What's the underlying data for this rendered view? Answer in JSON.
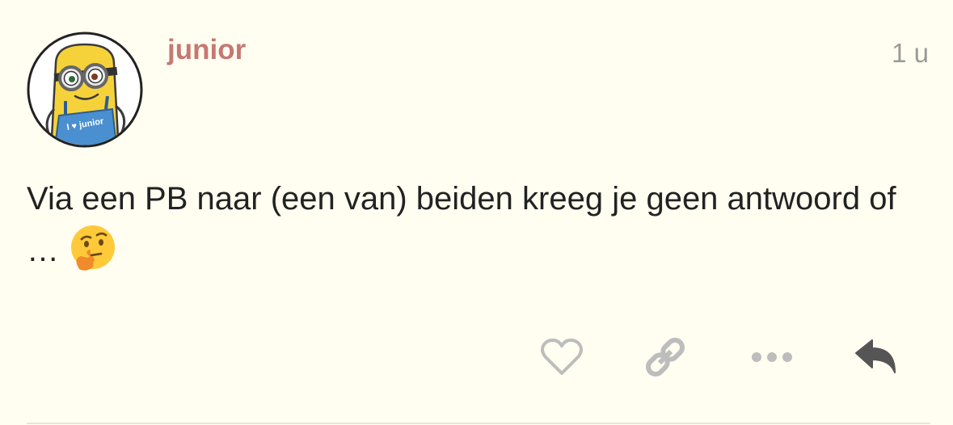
{
  "post": {
    "username": "junior",
    "date": "1 u",
    "text": "Via een PB naar (een van) beiden kreeg je geen antwoord of …",
    "emoji": "thinking-face-icon"
  },
  "avatar": {
    "badge_text": "I ♥ junior",
    "icon": "minion-avatar-icon"
  },
  "actions": [
    {
      "name": "like",
      "icon": "heart-icon"
    },
    {
      "name": "copy-link",
      "icon": "link-icon"
    },
    {
      "name": "more",
      "icon": "ellipsis-icon"
    },
    {
      "name": "reply",
      "icon": "reply-icon"
    }
  ],
  "colors": {
    "background": "#fffef1",
    "username": "#c67873",
    "date": "#9a9a9a",
    "text": "#222222",
    "icon_muted": "#bdbdbd",
    "icon_dark": "#555555"
  }
}
